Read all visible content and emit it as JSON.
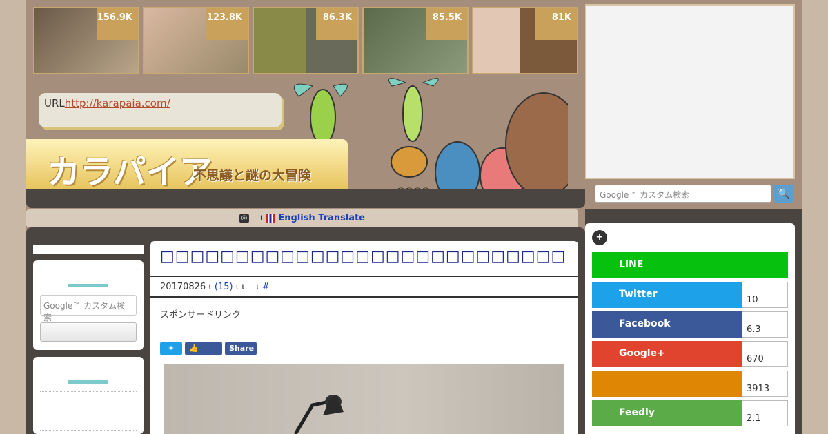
{
  "thumbs": [
    {
      "count": "156.9K",
      "colors": [
        "#6a5a48",
        "#b9a58a"
      ]
    },
    {
      "count": "123.8K",
      "colors": [
        "#d9b8a0",
        "#9a8a6a"
      ]
    },
    {
      "count": "86.3K",
      "colors": [
        "#8a8a48",
        "#6a6a5a"
      ]
    },
    {
      "count": "85.5K",
      "colors": [
        "#5a6a4a",
        "#8a9a7a"
      ]
    },
    {
      "count": "81K",
      "colors": [
        "#c9a88a",
        "#7a5a3a"
      ]
    }
  ],
  "header": {
    "url_label": "URL",
    "url": "http://karapaia.com/",
    "logo": "カラパイア",
    "tagline": "不思議と謎の大冒険"
  },
  "translate": {
    "sep": "ι",
    "label": "English Translate"
  },
  "left": {
    "search_placeholder": "Google™ カスタム検索"
  },
  "article": {
    "title": "□□□□□□□□□□□□□□□□□□□□□□□□□□□",
    "date": "20170826",
    "sep": "ι",
    "comments": "(15)",
    "sep2": "ι ι",
    "sep3": "ι",
    "hash": "#",
    "sponsor": "スポンサードリンク",
    "share": {
      "twitter": "",
      "like": "Like",
      "share": "Share"
    }
  },
  "search": {
    "placeholder": "Google™ カスタム検索",
    "button": "🔍"
  },
  "social": {
    "plus": "+",
    "items": [
      {
        "name": "LINE",
        "count": "",
        "color": "#06c20e"
      },
      {
        "name": "Twitter",
        "count": "10",
        "color": "#1da1e8"
      },
      {
        "name": "Facebook",
        "count": "6.3",
        "color": "#3b5998"
      },
      {
        "name": "Google+",
        "count": "670",
        "color": "#e0442f"
      },
      {
        "name": "",
        "count": "3913",
        "color": "#df8604"
      },
      {
        "name": "Feedly",
        "count": "2.1",
        "color": "#5cab49"
      }
    ]
  }
}
